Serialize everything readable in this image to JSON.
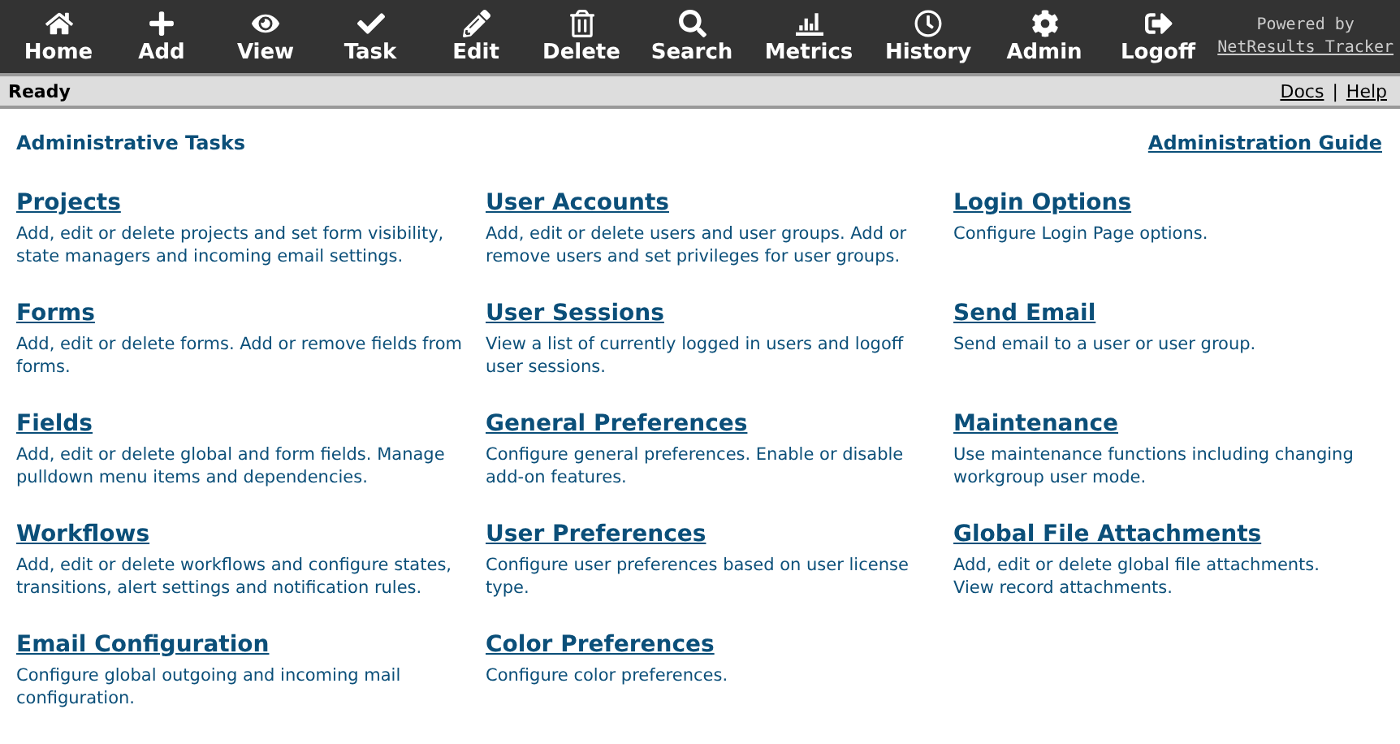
{
  "toolbar": {
    "buttons": [
      {
        "label": "Home"
      },
      {
        "label": "Add"
      },
      {
        "label": "View"
      },
      {
        "label": "Task"
      },
      {
        "label": "Edit"
      },
      {
        "label": "Delete"
      },
      {
        "label": "Search"
      },
      {
        "label": "Metrics"
      },
      {
        "label": "History"
      },
      {
        "label": "Admin"
      },
      {
        "label": "Logoff"
      }
    ],
    "powered_by": "Powered by",
    "brand_link": "NetResults Tracker"
  },
  "status_bar": {
    "status": "Ready",
    "links": [
      "Docs",
      "Help"
    ],
    "separator": "|"
  },
  "page": {
    "title": "Administrative Tasks",
    "guide_link": "Administration Guide",
    "tasks": [
      {
        "title": "Projects",
        "description": "Add, edit or delete projects and set form visibility, state managers and incoming email settings."
      },
      {
        "title": "User Accounts",
        "description": "Add, edit or delete users and user groups. Add or remove users and set privileges for user groups."
      },
      {
        "title": "Login Options",
        "description": "Configure Login Page options."
      },
      {
        "title": "Forms",
        "description": "Add, edit or delete forms. Add or remove fields from forms."
      },
      {
        "title": "User Sessions",
        "description": "View a list of currently logged in users and logoff user sessions."
      },
      {
        "title": "Send Email",
        "description": "Send email to a user or user group."
      },
      {
        "title": "Fields",
        "description": "Add, edit or delete global and form fields. Manage pulldown menu items and dependencies."
      },
      {
        "title": "General Preferences",
        "description": "Configure general preferences. Enable or disable add-on features."
      },
      {
        "title": "Maintenance",
        "description": "Use maintenance functions including changing workgroup user mode."
      },
      {
        "title": "Workflows",
        "description": "Add, edit or delete workflows and configure states, transitions, alert settings and notification rules."
      },
      {
        "title": "User Preferences",
        "description": "Configure user preferences based on user license type."
      },
      {
        "title": "Global File Attachments",
        "description": "Add, edit or delete global file attachments. View record attachments."
      },
      {
        "title": "Email Configuration",
        "description": "Configure global outgoing and incoming mail configuration."
      },
      {
        "title": "Color Preferences",
        "description": "Configure color preferences."
      }
    ]
  }
}
